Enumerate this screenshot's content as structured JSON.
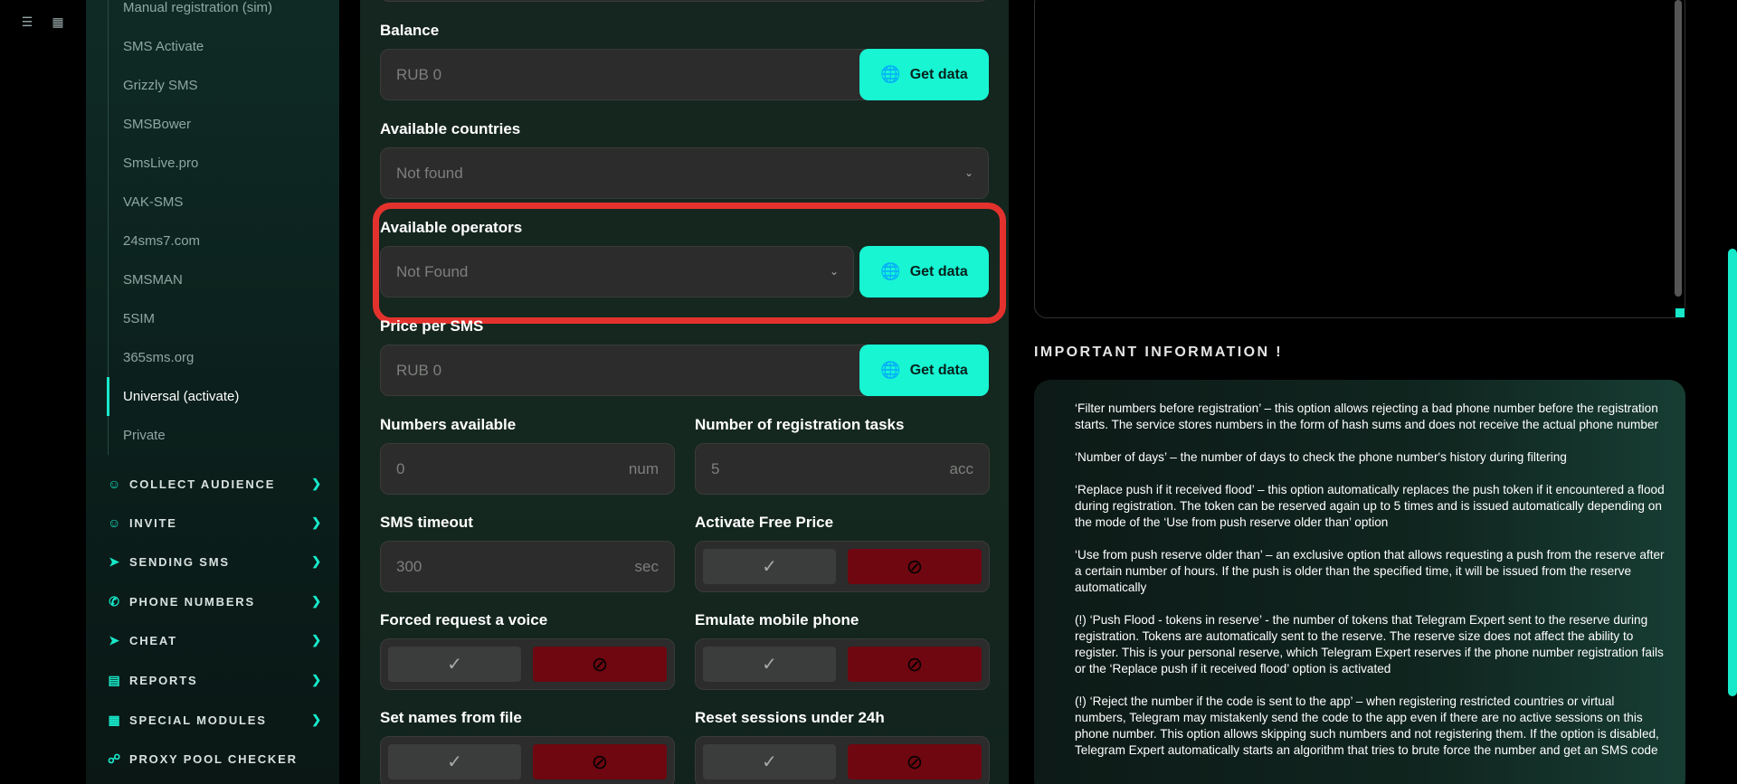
{
  "sidebar": {
    "subitems": [
      "Manual registration (sim)",
      "SMS Activate",
      "Grizzly SMS",
      "SMSBower",
      "SmsLive.pro",
      "VAK-SMS",
      "24sms7.com",
      "SMSMAN",
      "5SIM",
      "365sms.org",
      "Universal (activate)",
      "Private"
    ],
    "sections": [
      "COLLECT AUDIENCE",
      "INVITE",
      "SENDING SMS",
      "PHONE NUMBERS",
      "CHEAT",
      "REPORTS",
      "SPECIAL MODULES",
      "PROXY POOL CHECKER"
    ]
  },
  "form": {
    "balance_label": "Balance",
    "balance_value": "RUB   0",
    "get_data": "Get data",
    "countries_label": "Available countries",
    "countries_value": "Not found",
    "operators_label": "Available operators",
    "operators_value": "Not Found",
    "price_label": "Price per SMS",
    "price_value": "RUB   0",
    "numbers_label": "Numbers available",
    "numbers_value": "0",
    "numbers_unit": "num",
    "tasks_label": "Number of registration tasks",
    "tasks_value": "5",
    "tasks_unit": "acc",
    "timeout_label": "SMS timeout",
    "timeout_value": "300",
    "timeout_unit": "sec",
    "free_price_label": "Activate Free Price",
    "voice_label": "Forced request a voice",
    "emulate_label": "Emulate mobile phone",
    "names_label": "Set names from file",
    "reset_label": "Reset sessions under 24h"
  },
  "info": {
    "title": "IMPORTANT INFORMATION !",
    "paragraphs": [
      "‘Filter numbers before registration’ – this option allows rejecting a bad phone number before the registration starts. The service stores numbers in the form of hash sums and does not receive the actual phone number",
      "‘Number of days’ – the number of days to check the phone number's history during filtering",
      "‘Replace push if it received flood’ – this option automatically replaces the push token if it encountered a flood during registration. The token can be reserved again up to 5 times and is issued automatically depending on the mode of the ‘Use from push reserve older than’ option",
      "‘Use from push reserve older than’ – an exclusive option that allows requesting a push from the reserve after a certain number of hours. If the push is older than the specified time, it will be issued from the reserve automatically",
      "(!) ‘Push Flood - tokens in reserve’ - the number of tokens that Telegram Expert sent to the reserve during registration. Tokens are automatically sent to the reserve. The reserve size does not affect the ability to register. This is your personal reserve, which Telegram Expert reserves if the phone number registration fails or the ‘Replace push if it received flood’ option is activated",
      "(!) ‘Reject the number if the code is sent to the app’ – when registering restricted countries or virtual numbers, Telegram may mistakenly send the code to the app even if there are no active sessions on this phone number. This option allows skipping such numbers and not registering them. If the option is disabled, Telegram Expert automatically starts an algorithm that tries to brute force the number and get an SMS code"
    ]
  }
}
